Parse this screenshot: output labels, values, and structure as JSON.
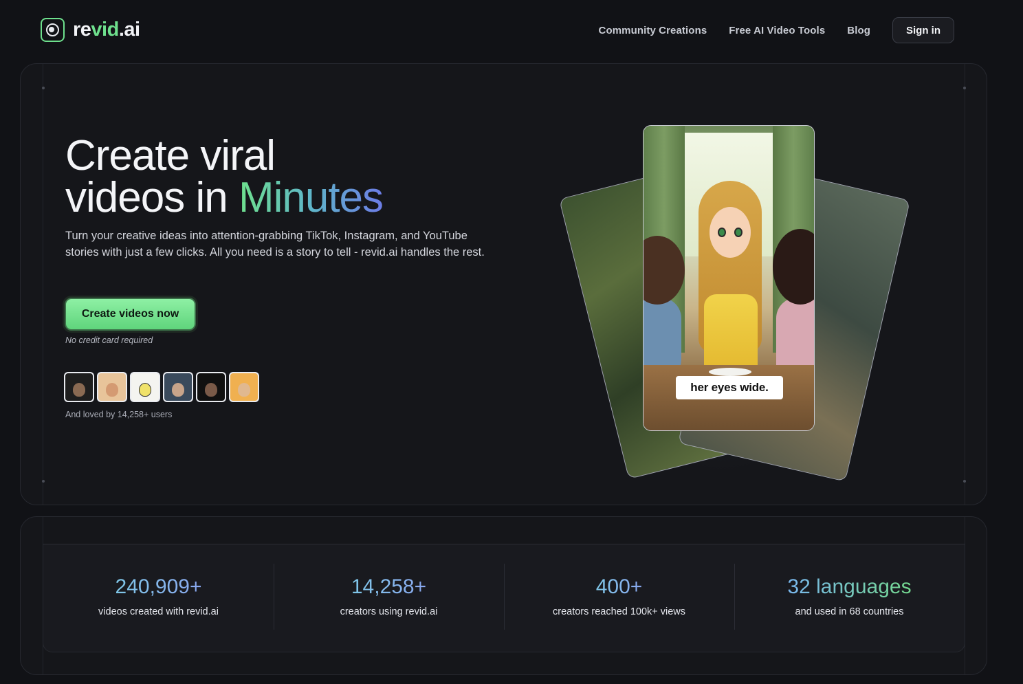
{
  "header": {
    "logo": {
      "prefix": "re",
      "accent": "vid",
      "suffix": ".ai"
    },
    "nav": [
      {
        "label": "Community Creations"
      },
      {
        "label": "Free AI Video Tools"
      },
      {
        "label": "Blog"
      }
    ],
    "signin_label": "Sign in"
  },
  "hero": {
    "headline_line1": "Create viral",
    "headline_line2_prefix": "videos in ",
    "headline_line2_accent": "Minutes",
    "subtext": "Turn your creative ideas into attention-grabbing TikTok, Instagram, and YouTube stories with just a few clicks. All you need is a story to tell - revid.ai handles the rest.",
    "cta_label": "Create videos now",
    "no_cc": "No credit card required",
    "loved": "And loved by 14,258+ users",
    "caption": "her eyes wide."
  },
  "stats": [
    {
      "value": "240,909+",
      "label": "videos created with revid.ai"
    },
    {
      "value": "14,258+",
      "label": "creators using revid.ai"
    },
    {
      "value": "400+",
      "label": "creators reached 100k+ views"
    },
    {
      "value": "32 languages",
      "label": "and used in 68 countries"
    }
  ],
  "colors": {
    "accent_green": "#6ee08d",
    "background": "#111216",
    "panel": "#15161a"
  }
}
